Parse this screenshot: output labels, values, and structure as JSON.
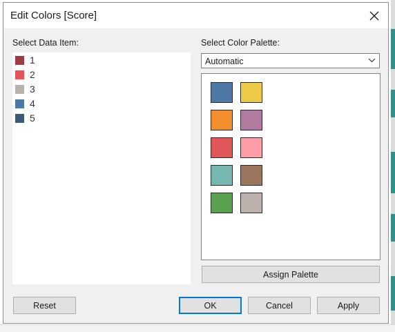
{
  "dialog": {
    "title": "Edit Colors [Score]",
    "close_icon": "close-icon"
  },
  "data_items": {
    "label": "Select Data Item:",
    "items": [
      {
        "label": "1",
        "color": "#a03c43"
      },
      {
        "label": "2",
        "color": "#e15759"
      },
      {
        "label": "3",
        "color": "#bab0ac"
      },
      {
        "label": "4",
        "color": "#4e79a7"
      },
      {
        "label": "5",
        "color": "#3b5a7a"
      }
    ]
  },
  "palette": {
    "label": "Select Color Palette:",
    "selected": "Automatic",
    "swatches": [
      [
        "#4e79a7",
        "#edc948"
      ],
      [
        "#f28e2b",
        "#b07aa1"
      ],
      [
        "#e15759",
        "#ff9da7"
      ],
      [
        "#76b7b2",
        "#9c755f"
      ],
      [
        "#59a14f",
        "#bab0ac"
      ]
    ],
    "assign_label": "Assign Palette"
  },
  "buttons": {
    "reset": "Reset",
    "ok": "OK",
    "cancel": "Cancel",
    "apply": "Apply"
  }
}
